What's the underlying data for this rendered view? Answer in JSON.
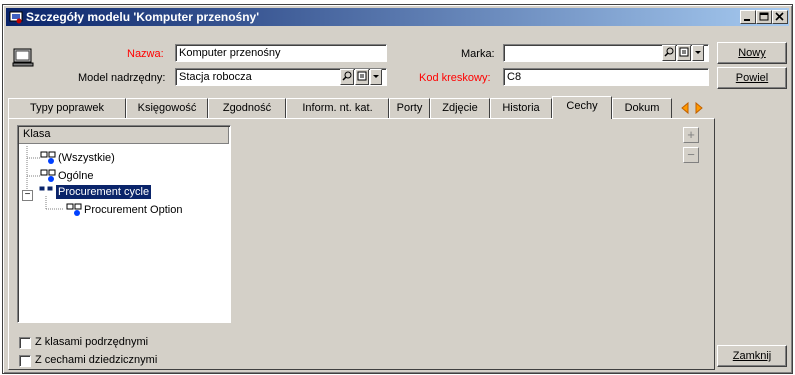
{
  "window": {
    "title": "Szczegóły modelu 'Komputer przenośny'"
  },
  "form": {
    "nazwa_label": "Nazwa:",
    "nazwa_value": "Komputer przenośny",
    "marka_label": "Marka:",
    "marka_value": "",
    "model_label": "Model nadrzędny:",
    "model_value": "Stacja robocza",
    "kod_label": "Kod kreskowy:",
    "kod_value": "C8"
  },
  "buttons": {
    "new": "Nowy",
    "duplicate": "Powiel",
    "close": "Zamknij"
  },
  "tabs": [
    {
      "label": "Typy poprawek"
    },
    {
      "label": "Księgowość"
    },
    {
      "label": "Zgodność"
    },
    {
      "label": "Inform. nt. kat."
    },
    {
      "label": "Porty"
    },
    {
      "label": "Zdjęcie"
    },
    {
      "label": "Historia"
    },
    {
      "label": "Cechy"
    },
    {
      "label": "Dokum"
    }
  ],
  "active_tab": "Cechy",
  "tree": {
    "header": "Klasa",
    "nodes": [
      {
        "label": "(Wszystkie)"
      },
      {
        "label": "Ogólne"
      },
      {
        "label": "Procurement cycle",
        "expanded": true,
        "selected": true
      },
      {
        "label": "Procurement Option"
      }
    ],
    "expander_symbol": "−"
  },
  "side_buttons": {
    "add": "+",
    "remove": "−"
  },
  "checkboxes": [
    {
      "label": "Z klasami podrzędnymi",
      "checked": false
    },
    {
      "label": "Z cechami dziedzicznymi",
      "checked": false
    }
  ],
  "colors": {
    "required_label": "#ff0000",
    "title_bar": "#0a246a",
    "selection": "#0a246a"
  }
}
